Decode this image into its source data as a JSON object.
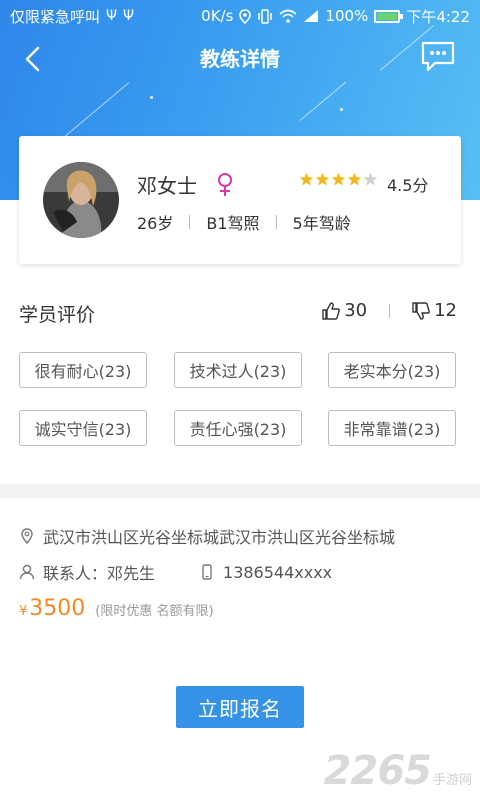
{
  "status_bar": {
    "left_text": "仅限紧急呼叫",
    "usb_icons": [
      "usb-icon",
      "usb-icon"
    ],
    "speed": "0K/s",
    "battery": "100%",
    "time": "下午4:22"
  },
  "nav": {
    "title": "教练详情",
    "back_icon": "chevron-left-icon",
    "action_icon": "chat-bubble-icon"
  },
  "coach": {
    "name": "邓女士",
    "gender_icon": "female-symbol-icon",
    "rating_stars": 4,
    "rating_max": 5,
    "rating_text": "4.5分",
    "age": "26岁",
    "license": "B1驾照",
    "experience": "5年驾龄"
  },
  "reviews": {
    "title": "学员评价",
    "likes": "30",
    "dislikes": "12",
    "tags": [
      "很有耐心(23)",
      "技术过人(23)",
      "老实本分(23)",
      "诚实守信(23)",
      "责任心强(23)",
      "非常靠谱(23)"
    ]
  },
  "info": {
    "address": "武汉市洪山区光谷坐标城武汉市洪山区光谷坐标城",
    "contact": "联系人：邓先生",
    "phone": "1386544xxxx"
  },
  "price": {
    "currency": "¥",
    "amount": "3500",
    "note": "(限时优惠 名额有限)"
  },
  "signup_label": "立即报名",
  "watermark": {
    "main": "2265",
    "sub": "手游网"
  },
  "colors": {
    "brand_blue": "#3592e6",
    "price_orange": "#f08a24",
    "female_pink": "#d63aa8",
    "star_gold": "#f5b820"
  }
}
